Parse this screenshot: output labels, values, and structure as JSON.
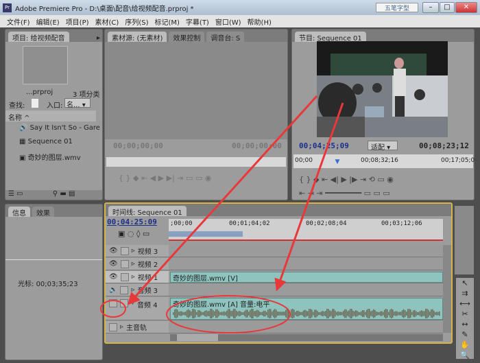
{
  "window": {
    "title": "Adobe Premiere Pro - D:\\桌面\\配音\\给视频配音.prproj *",
    "watermark": "五笔字型",
    "app_icon": "Pr"
  },
  "menu": [
    "文件(F)",
    "编辑(E)",
    "项目(P)",
    "素材(C)",
    "序列(S)",
    "标记(M)",
    "字幕(T)",
    "窗口(W)",
    "帮助(H)"
  ],
  "project": {
    "tab": "项目: 给视频配音",
    "file": "...prproj",
    "count": "3 项分类",
    "find_label": "查找:",
    "entry_label": "入口:",
    "entry_value": "名...",
    "column": "名称",
    "items": [
      {
        "name": "Say It Isn't So - Gare",
        "icon": "audio-icon"
      },
      {
        "name": "Sequence 01",
        "icon": "sequence-icon"
      },
      {
        "name": "奇妙的图层.wmv",
        "icon": "video-file-icon"
      }
    ]
  },
  "source": {
    "tabs": [
      "素材源: (无素材)",
      "效果控制",
      "调音台: S"
    ],
    "tc_left": "00;00;00;00",
    "tc_right": "00;00;00;00"
  },
  "program": {
    "tab": "节目: Sequence 01",
    "tc_current": "00;04;25;09",
    "fit": "适配",
    "tc_duration": "00;08;23;12",
    "ruler": [
      "00;00",
      "00;08;32;16",
      "00;17;05;0"
    ],
    "playhead_fraction": 0.25
  },
  "info": {
    "tabs": [
      "信息",
      "效果"
    ],
    "cursor_label": "光标:",
    "cursor_value": "00;03;35;23"
  },
  "timeline": {
    "tab": "时间线: Sequence 01",
    "tc": "00;04:25:09",
    "ruler": [
      ";00;00",
      "00;01;04;02",
      "00;02;08;04",
      "00;03;12;06"
    ],
    "tracks": {
      "v3": "视频 3",
      "v2": "视频 2",
      "v1": "视频 1",
      "a3": "音频 3",
      "a4": "音频 4",
      "master": "主音轨"
    },
    "v_clip": "奇妙的图层.wmv [V]",
    "a_clip": "奇妙的图层.wmv [A] 音量:电平"
  },
  "colors": {
    "annotation": "#e8383a",
    "timecode": "#1b2f8a",
    "clip": "#8fc3bd",
    "active_border": "#d6b44a"
  }
}
